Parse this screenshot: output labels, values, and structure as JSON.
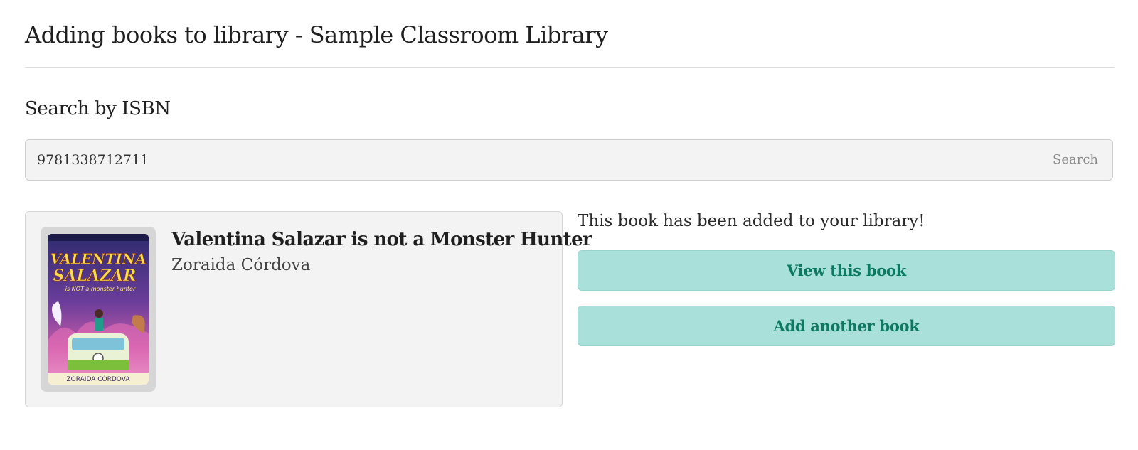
{
  "header": {
    "title": "Adding books to library - Sample Classroom Library"
  },
  "search": {
    "heading": "Search by ISBN",
    "value": "9781338712711",
    "button_label": "Search"
  },
  "book": {
    "title": "Valentina Salazar is not a Monster Hunter",
    "author": "Zoraida Córdova",
    "cover": {
      "title_line1": "VALENTINA",
      "title_line2": "SALAZAR",
      "title_line3": "is NOT a monster hunter",
      "author": "ZORAIDA CÓRDOVA"
    }
  },
  "result": {
    "message": "This book has been added to your library!",
    "view_button": "View this book",
    "add_button": "Add another book"
  },
  "colors": {
    "accent_button_bg": "#a9e0da",
    "accent_button_text": "#0c7a63",
    "panel_bg": "#f3f3f3"
  }
}
